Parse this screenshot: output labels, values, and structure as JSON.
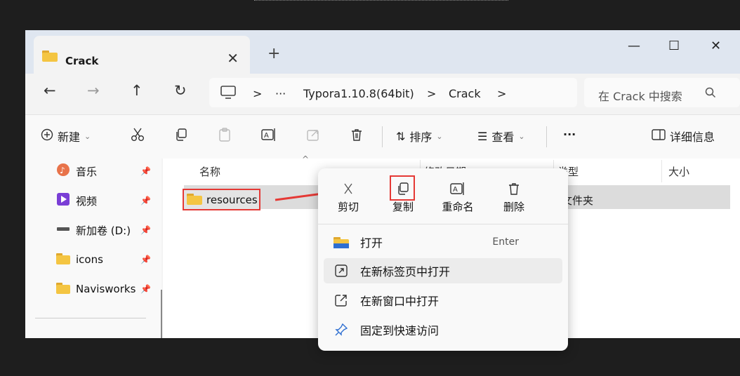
{
  "window": {
    "tab_title": "Crack",
    "tab_close": "✕",
    "new_tab": "+",
    "controls": {
      "minimize": "—",
      "maximize": "☐",
      "close": "✕"
    }
  },
  "nav": {
    "back": "←",
    "forward": "→",
    "up": "↑",
    "refresh": "↻"
  },
  "address": {
    "sep1": ">",
    "ellipsis": "···",
    "crumb1": "Typora1.10.8(64bit)",
    "sep2": ">",
    "crumb2": "Crack",
    "sep3": ">"
  },
  "search": {
    "placeholder": "在 Crack 中搜索"
  },
  "toolbar": {
    "new_label": "新建",
    "sort_label": "排序",
    "view_label": "查看",
    "more_label": "···",
    "details_label": "详细信息"
  },
  "sidebar": {
    "items": [
      {
        "label": "音乐",
        "icon": "music-icon"
      },
      {
        "label": "视频",
        "icon": "video-icon"
      },
      {
        "label": "新加卷 (D:)",
        "icon": "drive-icon"
      },
      {
        "label": "icons",
        "icon": "folder-icon"
      },
      {
        "label": "Navisworks",
        "icon": "folder-icon"
      }
    ]
  },
  "columns": {
    "name": "名称",
    "date": "修改日期",
    "type": "类型",
    "size": "大小"
  },
  "files": [
    {
      "name": "resources",
      "type": "文件夹"
    }
  ],
  "context_menu": {
    "top": {
      "cut": "剪切",
      "copy": "复制",
      "rename": "重命名",
      "delete": "删除"
    },
    "items": [
      {
        "label": "打开",
        "shortcut": "Enter"
      },
      {
        "label": "在新标签页中打开"
      },
      {
        "label": "在新窗口中打开"
      },
      {
        "label": "固定到快速访问"
      }
    ]
  },
  "colors": {
    "highlight": "#e53935",
    "folder": "#f4c542",
    "accent": "#0067c0"
  }
}
